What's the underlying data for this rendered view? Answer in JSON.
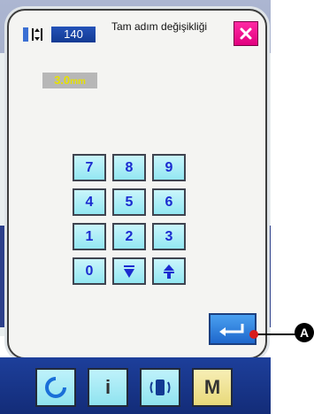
{
  "dialog": {
    "value": "140",
    "title": "Tam adım değişikliği",
    "step": {
      "value": "3.0",
      "unit": "mm"
    }
  },
  "keypad": {
    "keys": [
      "7",
      "8",
      "9",
      "4",
      "5",
      "6",
      "1",
      "2",
      "3",
      "0"
    ]
  },
  "toolbar": {
    "info_label": "i",
    "menu_label": "M"
  },
  "callout": {
    "label": "A"
  },
  "colors": {
    "close": "#e1007f",
    "key_text": "#1b2bd0",
    "toolbar": "#1d3f9b",
    "enter": "#1e67cc"
  }
}
